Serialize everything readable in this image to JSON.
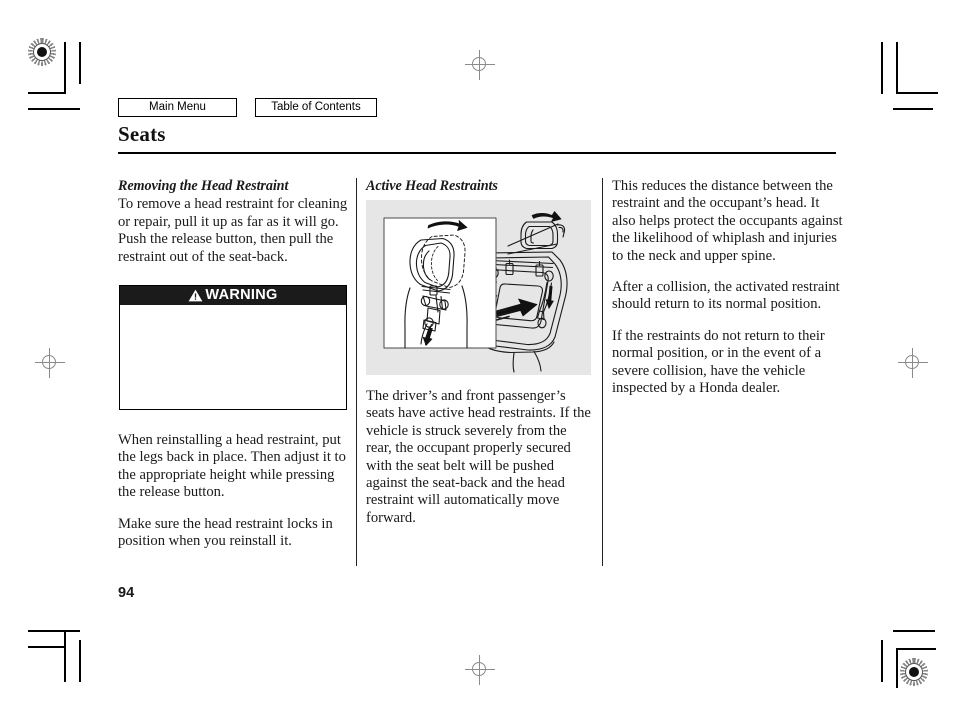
{
  "nav": {
    "main_menu": "Main Menu",
    "table_of_contents": "Table of Contents"
  },
  "header": {
    "title": "Seats"
  },
  "columns": {
    "left": {
      "subhead": "Removing the Head Restraint",
      "para1": "To remove a head restraint for cleaning or repair, pull it up as far as it will go. Push the release button, then pull the restraint out of the seat-back.",
      "warning": {
        "label": "WARNING",
        "icon": "warning-triangle-icon",
        "body": ""
      },
      "para2": "When reinstalling a head restraint, put the legs back in place. Then adjust it to the appropriate height while pressing the release button.",
      "para3": "Make sure the head restraint locks in position when you reinstall it."
    },
    "middle": {
      "subhead": "Active Head Restraints",
      "figure_name": "active-head-restraint-diagram",
      "para1": "The driver’s and front passenger’s seats have active head restraints. If the vehicle is struck severely from the rear, the occupant properly secured with the seat belt will be pushed against the seat-back and the head restraint will automatically move forward."
    },
    "right": {
      "para1": "This reduces the distance between the restraint and the occupant’s head. It also helps protect the occupants against the likelihood of whiplash and injuries to the neck and upper spine.",
      "para2": "After a collision, the activated restraint should return to its normal position.",
      "para3": "If the restraints do not return to their normal position, or in the event of a severe collision, have the vehicle inspected by a Honda dealer."
    }
  },
  "footer": {
    "page_number": "94"
  },
  "colors": {
    "text": "#1a1a1a",
    "rule": "#000000",
    "warning_bar": "#1b1b1b",
    "figure_background": "#e6e6e6",
    "registration_mark": "#8a8a8a"
  }
}
